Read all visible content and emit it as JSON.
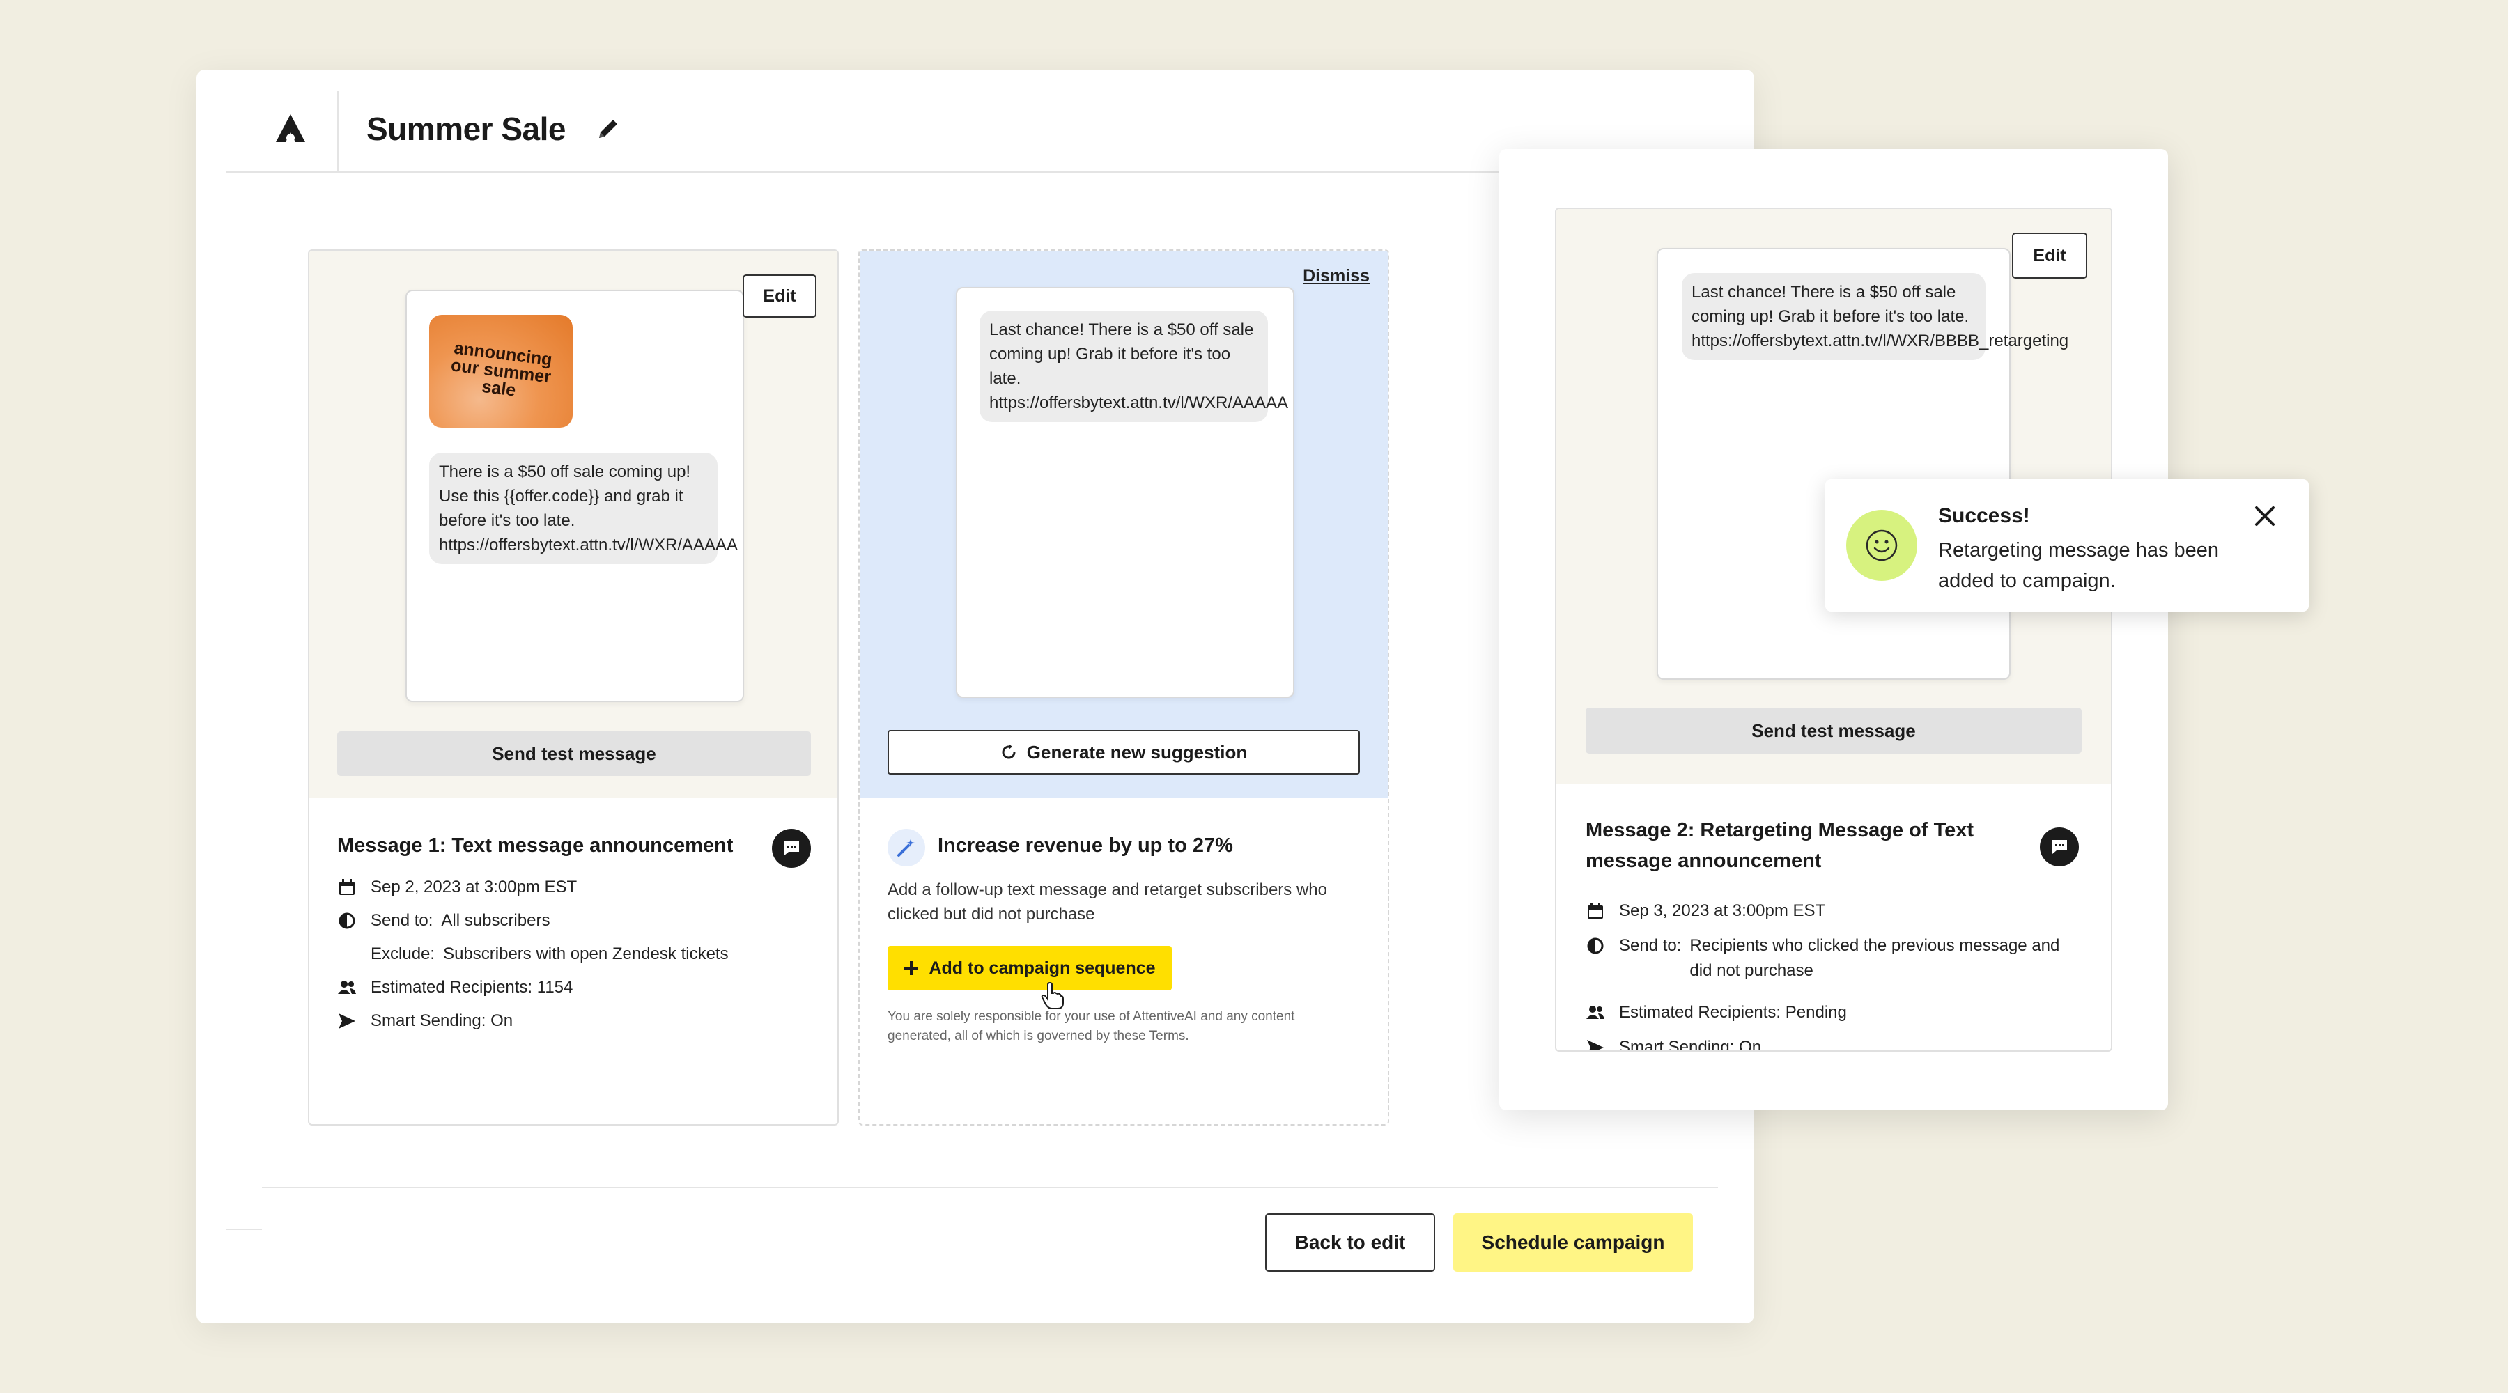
{
  "header": {
    "title": "Summer Sale"
  },
  "message1": {
    "edit_label": "Edit",
    "promo_image_text": "announcing our summer sale",
    "bubble_text": "There is a $50 off sale coming up! Use this {{offer.code}} and grab it before it's too late. https://offersbytext.attn.tv/l/WXR/AAAAA",
    "send_test_label": "Send test message",
    "title": "Message 1: Text message announcement",
    "date": "Sep 2, 2023 at 3:00pm EST",
    "send_to_label": "Send to:",
    "send_to_value": "All subscribers",
    "exclude_label": "Exclude:",
    "exclude_value": "Subscribers with open Zendesk tickets",
    "recipients": "Estimated Recipients: 1154",
    "smart_sending": "Smart Sending: On"
  },
  "suggestion": {
    "dismiss_label": "Dismiss",
    "bubble_text": "Last chance! There is a $50 off sale coming up! Grab it before it's too late. https://offersbytext.attn.tv/l/WXR/AAAAA",
    "generate_label": "Generate new suggestion",
    "title": "Increase revenue by up to 27%",
    "description": "Add a follow-up text message and retarget subscribers who clicked but did not purchase",
    "add_label": "Add to campaign sequence",
    "disclaimer": "You are solely responsible for your use of AttentiveAI and any content generated, all of which is governed by these",
    "terms_label": "Terms",
    "terms_suffix": "."
  },
  "message2": {
    "edit_label": "Edit",
    "bubble_text": "Last chance! There is a $50 off sale coming up! Grab it before it's too late. https://offersbytext.attn.tv/l/WXR/BBBB_retargeting",
    "send_test_label": "Send test message",
    "title": "Message 2: Retargeting Message of Text message announcement",
    "date": "Sep 3, 2023 at 3:00pm EST",
    "send_to_label": "Send to:",
    "send_to_value": "Recipients who clicked the previous message and did not purchase",
    "recipients": "Estimated Recipients: Pending",
    "smart_sending": "Smart Sending: On"
  },
  "toast": {
    "title": "Success!",
    "body": "Retargeting message has been added to campaign."
  },
  "footer": {
    "back_label": "Back to edit",
    "schedule_label": "Schedule campaign"
  },
  "colors": {
    "background": "#f1eee1",
    "accent_yellow": "#ffdf00",
    "schedule_yellow": "#fff585",
    "suggestion_blue": "#dde9fa",
    "success_green": "#d7f27f"
  },
  "icons": [
    "attentive-logo-icon",
    "pencil-icon",
    "refresh-icon",
    "wand-icon",
    "plus-icon",
    "cursor-hand-icon",
    "calendar-icon",
    "audience-icon",
    "people-icon",
    "send-icon",
    "chat-bubble-icon",
    "smiley-icon",
    "close-icon"
  ]
}
